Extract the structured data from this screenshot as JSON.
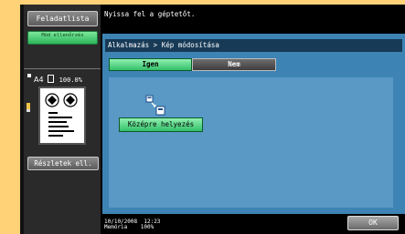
{
  "left_panel": {
    "task_list_label": "Feladatlista",
    "check_label": "Mód ellenőrzés",
    "paper_size": "A4",
    "zoom": "100.0%",
    "details_label": "Részletek ell."
  },
  "header": {
    "message": "Nyissa fel a géptetőt."
  },
  "main": {
    "breadcrumb": "Alkalmazás > Kép módosítása",
    "yes_label": "Igen",
    "no_label": "Nem",
    "center_label": "Középre helyezés"
  },
  "footer": {
    "date": "10/10/2008",
    "time": "12:23",
    "memory_label": "Memória",
    "memory_value": "100%",
    "ok_label": "OK"
  },
  "colors": {
    "background": "#ffd278",
    "panel": "#2a2a2a",
    "main_blue": "#3d84b4",
    "green_button": "#33c06a"
  }
}
